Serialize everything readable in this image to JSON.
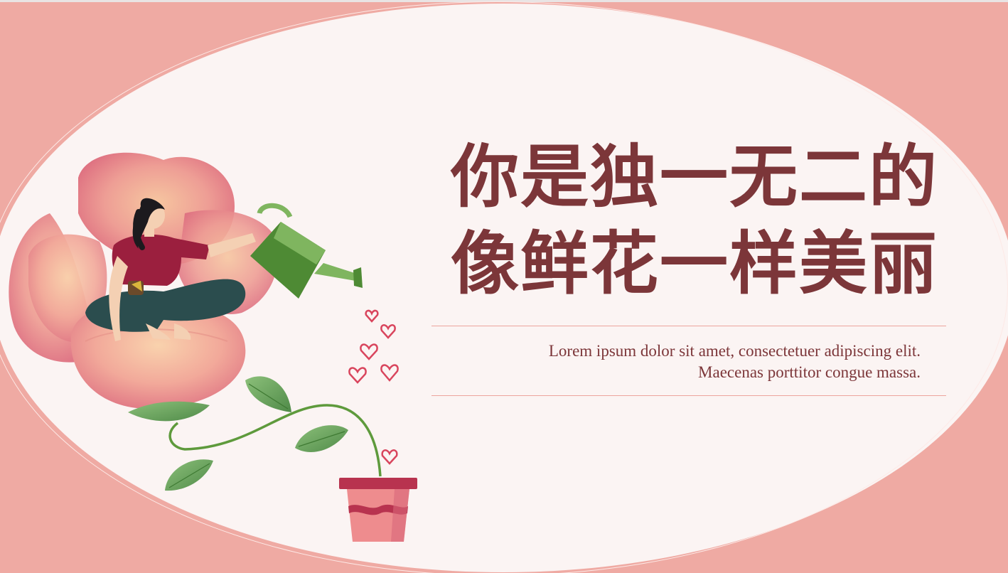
{
  "title": {
    "line1": "你是独一无二的",
    "line2": "像鲜花一样美丽"
  },
  "subtitle": {
    "line1": "Lorem ipsum dolor sit amet, consectetuer adipiscing elit.",
    "line2": "Maecenas porttitor congue massa."
  },
  "colors": {
    "background": "#efaaa3",
    "oval": "#fbf4f3",
    "title_text": "#7c3639",
    "divider": "#eca49d"
  },
  "illustration": {
    "icons": [
      "flower-icon",
      "woman-icon",
      "watering-can-icon",
      "hearts-icon",
      "vine-icon",
      "flower-pot-icon"
    ]
  }
}
